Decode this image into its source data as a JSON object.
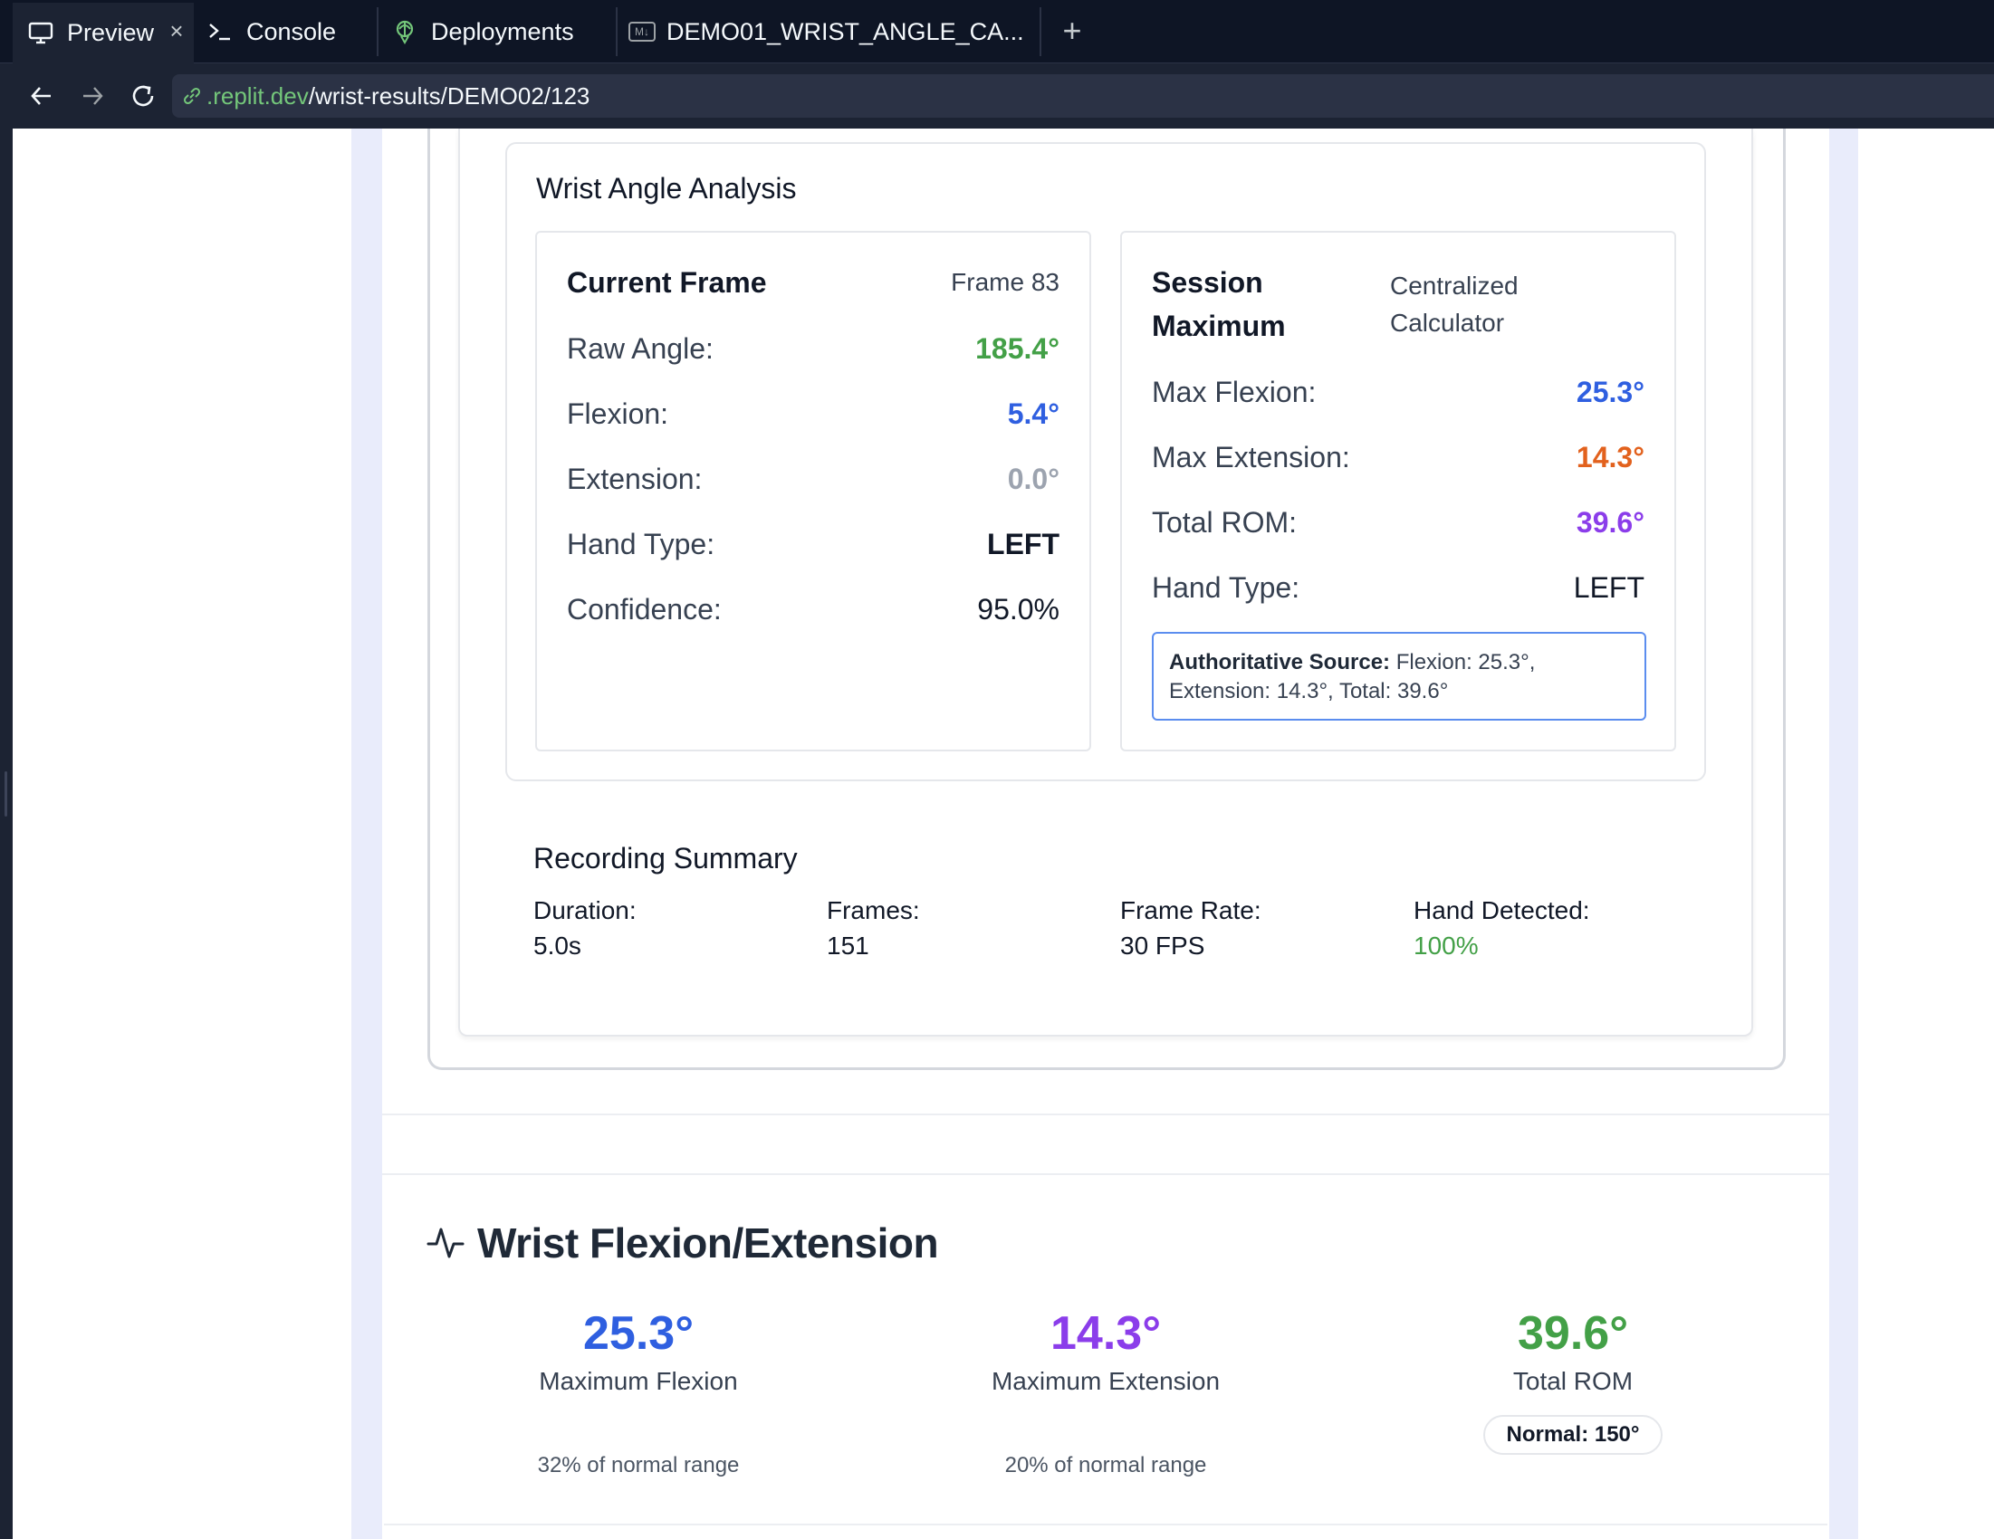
{
  "browser": {
    "tabs": [
      {
        "label": "Preview",
        "icon": "monitor-icon"
      },
      {
        "label": "Console",
        "icon": "terminal-icon"
      },
      {
        "label": "Deployments",
        "icon": "deployments-icon"
      },
      {
        "label": "DEMO01_WRIST_ANGLE_CA...",
        "icon": "markdown-file-icon",
        "icon_text": "M↓"
      }
    ],
    "close_glyph": "×",
    "new_tab_glyph": "+",
    "url": {
      "host": ".replit.dev",
      "path": "/wrist-results/DEMO02/123"
    }
  },
  "analysis": {
    "title": "Wrist Angle Analysis",
    "current_frame": {
      "title": "Current Frame",
      "frame_label": "Frame 83",
      "rows": [
        {
          "label": "Raw Angle:",
          "value": "185.4°",
          "color": "#43a047"
        },
        {
          "label": "Flexion:",
          "value": "5.4°",
          "color": "#2f5fe0"
        },
        {
          "label": "Extension:",
          "value": "0.0°",
          "color": "#9ca3af"
        },
        {
          "label": "Hand Type:",
          "value": "LEFT",
          "color": "#111827"
        },
        {
          "label": "Confidence:",
          "value": "95.0%",
          "color": "#111827"
        }
      ]
    },
    "session_max": {
      "title_line1": "Session",
      "title_line2": "Maximum",
      "subtitle_line1": "Centralized",
      "subtitle_line2": "Calculator",
      "rows": [
        {
          "label": "Max Flexion:",
          "value": "25.3°",
          "color": "#2f5fe0"
        },
        {
          "label": "Max Extension:",
          "value": "14.3°",
          "color": "#e2611d"
        },
        {
          "label": "Total ROM:",
          "value": "39.6°",
          "color": "#8b3dea"
        },
        {
          "label": "Hand Type:",
          "value": "LEFT",
          "color": "#111827"
        }
      ],
      "authoritative_label": "Authoritative Source:",
      "authoritative_line1": " Flexion: 25.3°,",
      "authoritative_line2": "Extension: 14.3°, Total: 39.6°"
    }
  },
  "summary": {
    "title": "Recording Summary",
    "items": [
      {
        "label": "Duration:",
        "value": "5.0s"
      },
      {
        "label": "Frames:",
        "value": "151"
      },
      {
        "label": "Frame Rate:",
        "value": "30 FPS"
      },
      {
        "label": "Hand Detected:",
        "value": "100%",
        "color": "#43a047"
      }
    ]
  },
  "flexion_extension": {
    "title": "Wrist Flexion/Extension",
    "icon": "activity-pulse-icon",
    "stats": [
      {
        "value": "25.3°",
        "label": "Maximum Flexion",
        "note": "32% of normal range",
        "color": "#2f5fe0"
      },
      {
        "value": "14.3°",
        "label": "Maximum Extension",
        "note": "20% of normal range",
        "color": "#8b3dea"
      },
      {
        "value": "39.6°",
        "label": "Total ROM",
        "badge": "Normal: 150°",
        "color": "#43a047"
      }
    ]
  }
}
